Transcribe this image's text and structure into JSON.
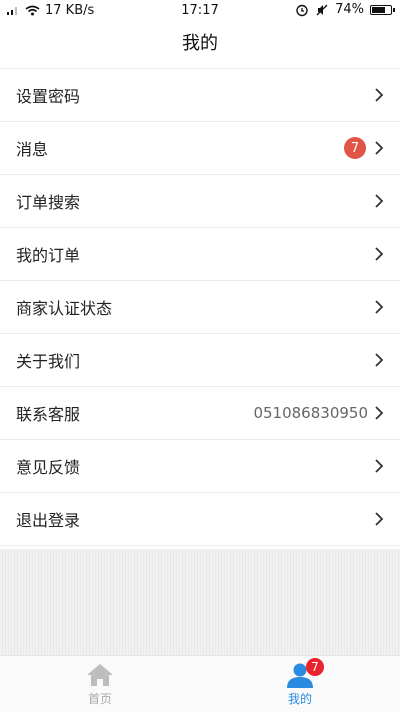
{
  "status_bar": {
    "signal_text": "ᵃˡ",
    "speed": "17 KB/s",
    "time": "17:17",
    "battery": "74%",
    "battery_level": 0.74
  },
  "header": {
    "title": "我的"
  },
  "menu": [
    {
      "label": "设置密码"
    },
    {
      "label": "消息",
      "badge": "7"
    },
    {
      "label": "订单搜索"
    },
    {
      "label": "我的订单"
    },
    {
      "label": "商家认证状态"
    },
    {
      "label": "关于我们"
    },
    {
      "label": "联系客服",
      "value": "051086830950"
    },
    {
      "label": "意见反馈"
    },
    {
      "label": "退出登录"
    }
  ],
  "tabs": [
    {
      "label": "首页",
      "icon": "home-icon",
      "active": false
    },
    {
      "label": "我的",
      "icon": "user-icon",
      "active": true,
      "badge": "7"
    }
  ],
  "colors": {
    "accent": "#2b8be0",
    "badge": "#e05545",
    "inactive": "#aaaaaa"
  }
}
